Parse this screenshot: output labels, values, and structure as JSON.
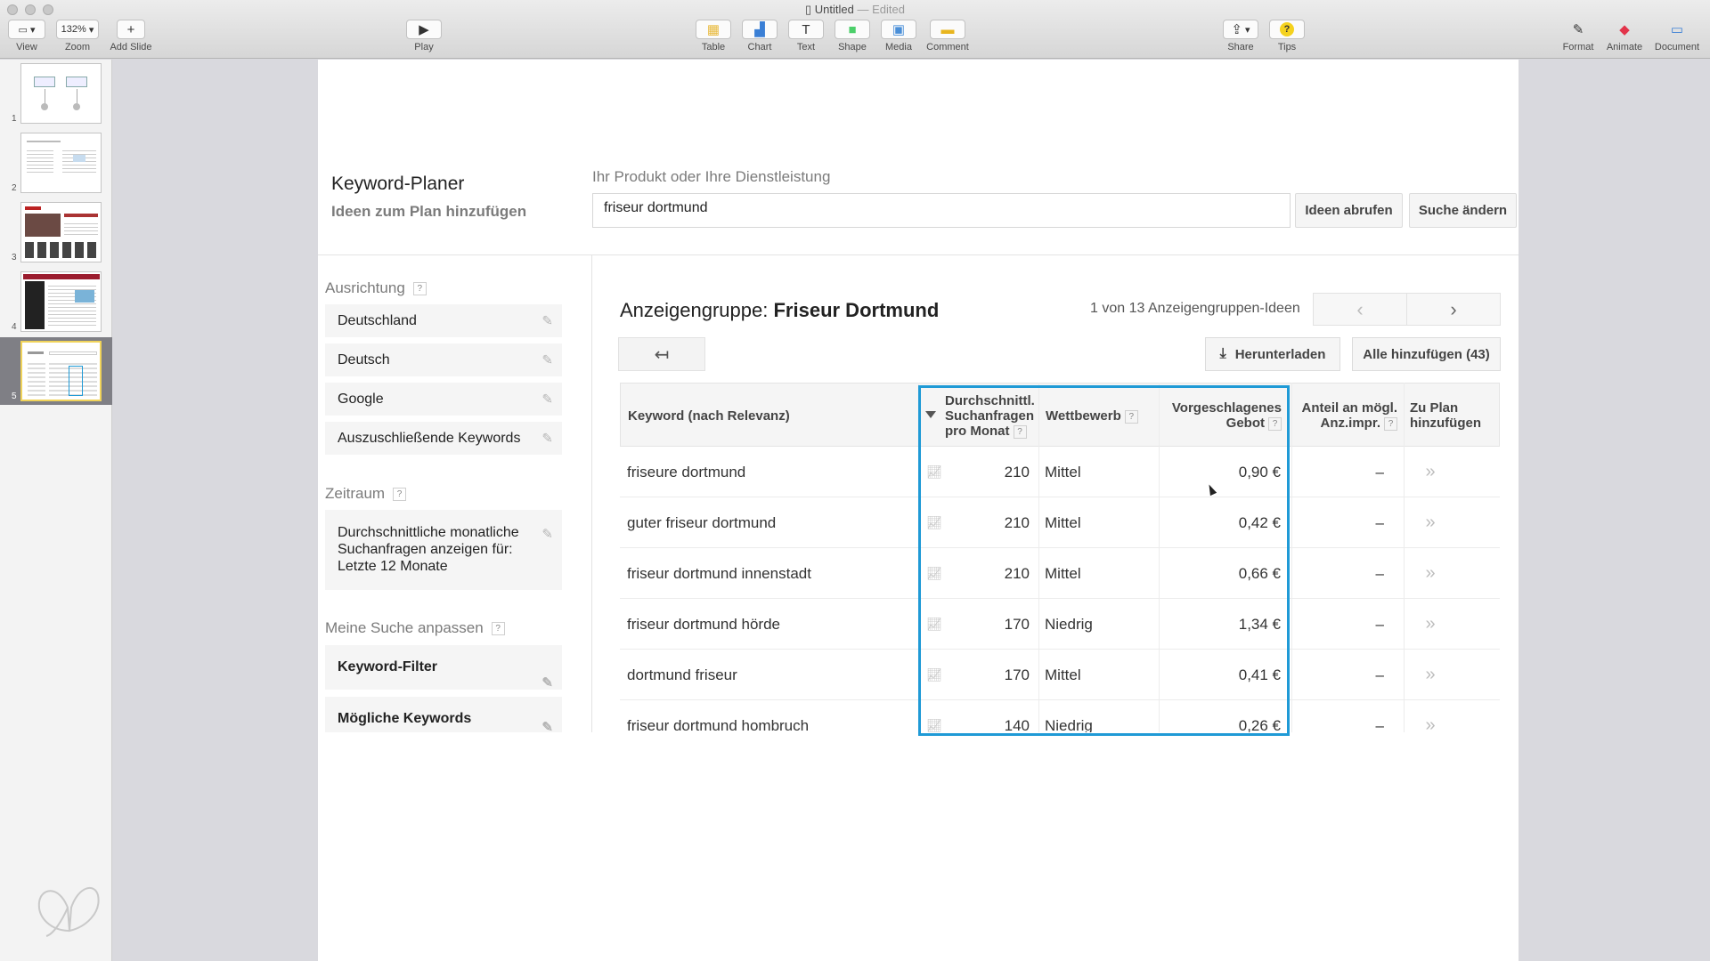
{
  "window": {
    "title": "Untitled",
    "status": "Edited"
  },
  "toolbar": {
    "view_label": "View",
    "zoom_value": "132%",
    "zoom_label": "Zoom",
    "add_slide_label": "Add Slide",
    "play_label": "Play",
    "table_label": "Table",
    "chart_label": "Chart",
    "text_label": "Text",
    "shape_label": "Shape",
    "media_label": "Media",
    "comment_label": "Comment",
    "share_label": "Share",
    "tips_label": "Tips",
    "format_label": "Format",
    "animate_label": "Animate",
    "document_label": "Document"
  },
  "navigator": {
    "slides": [
      "1",
      "2",
      "3",
      "4",
      "5"
    ],
    "selected": "5"
  },
  "slide": {
    "planner_title": "Keyword-Planer",
    "planner_subtitle": "Ideen zum Plan hinzufügen",
    "product_label": "Ihr Produkt oder Ihre Dienstleistung",
    "product_value": "friseur dortmund",
    "get_ideas_button": "Ideen abrufen",
    "modify_search_button": "Suche ändern",
    "targeting_heading": "Ausrichtung",
    "targeting_items": [
      "Deutschland",
      "Deutsch",
      "Google",
      "Auszuschließende Keywords"
    ],
    "timeframe_heading": "Zeitraum",
    "timeframe_text": [
      "Durchschnittliche monatliche",
      "Suchanfragen anzeigen für:",
      "Letzte 12 Monate"
    ],
    "customize_heading": "Meine Suche anpassen",
    "keyword_filter_label": "Keyword-Filter",
    "possible_keywords_label": "Mögliche Keywords",
    "adgroup_prefix": "Anzeigengruppe:",
    "adgroup_name": "Friseur Dortmund",
    "adgroup_count": "1 von 13 Anzeigengruppen-Ideen",
    "download_button": "Herunterladen",
    "add_all_button": "Alle hinzufügen (43)",
    "question_mark": "?",
    "columns": {
      "keyword": "Keyword (nach Relevanz)",
      "avg_searches": [
        "Durchschnittl.",
        "Suchanfragen",
        "pro Monat"
      ],
      "competition": "Wettbewerb",
      "suggested_bid": [
        "Vorgeschlagenes",
        "Gebot"
      ],
      "impr_share": [
        "Anteil an mögl.",
        "Anz.impr."
      ],
      "add_to_plan": [
        "Zu Plan",
        "hinzufügen"
      ]
    },
    "rows": [
      {
        "keyword": "friseure dortmund",
        "searches": "210",
        "competition": "Mittel",
        "bid": "0,90 €",
        "share": "–"
      },
      {
        "keyword": "guter friseur dortmund",
        "searches": "210",
        "competition": "Mittel",
        "bid": "0,42 €",
        "share": "–"
      },
      {
        "keyword": "friseur dortmund innenstadt",
        "searches": "210",
        "competition": "Mittel",
        "bid": "0,66 €",
        "share": "–"
      },
      {
        "keyword": "friseur dortmund hörde",
        "searches": "170",
        "competition": "Niedrig",
        "bid": "1,34 €",
        "share": "–"
      },
      {
        "keyword": "dortmund friseur",
        "searches": "170",
        "competition": "Mittel",
        "bid": "0,41 €",
        "share": "–"
      },
      {
        "keyword": "friseur dortmund hombruch",
        "searches": "140",
        "competition": "Niedrig",
        "bid": "0,26 €",
        "share": "–"
      }
    ]
  },
  "colors": {
    "highlight": "#1f9ad6",
    "selection": "#7f7f85"
  }
}
